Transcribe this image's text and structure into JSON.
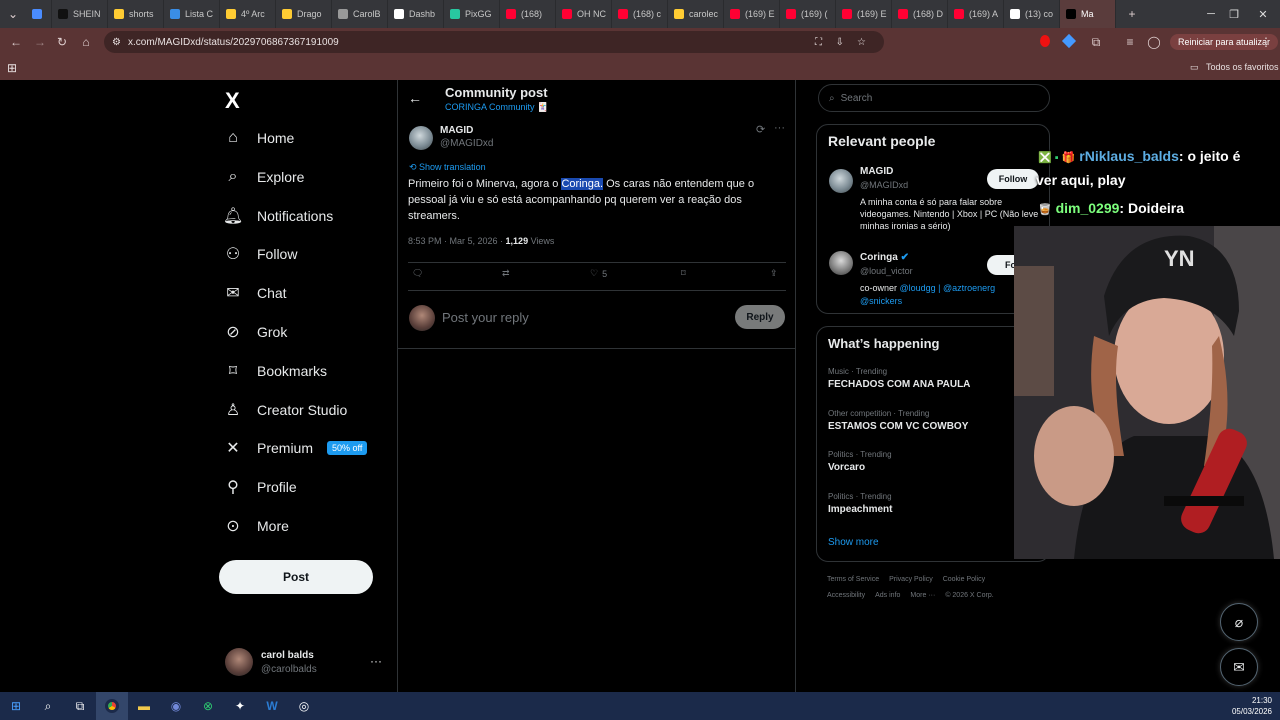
{
  "browser": {
    "tabs": [
      {
        "label": "",
        "color": "#4a8cff"
      },
      {
        "label": "SHEIN",
        "color": "#111111"
      },
      {
        "label": "shorts",
        "color": "#ffcc33"
      },
      {
        "label": "Lista C",
        "color": "#3a8ee6"
      },
      {
        "label": "4º Arc",
        "color": "#ffcc33"
      },
      {
        "label": "Drago",
        "color": "#ffcc33"
      },
      {
        "label": "CarolB",
        "color": "#999999"
      },
      {
        "label": "Dashb",
        "color": "#ffffff"
      },
      {
        "label": "PixGG",
        "color": "#28c7a0"
      },
      {
        "label": "(168) ",
        "color": "#ff0033"
      },
      {
        "label": "OH NC",
        "color": "#ff0033"
      },
      {
        "label": "(168) c",
        "color": "#ff0033"
      },
      {
        "label": "carolec",
        "color": "#ffcc33"
      },
      {
        "label": "(169) E",
        "color": "#ff0033"
      },
      {
        "label": "(169) (",
        "color": "#ff0033"
      },
      {
        "label": "(169) E",
        "color": "#ff0033"
      },
      {
        "label": "(168) D",
        "color": "#ff0033"
      },
      {
        "label": "(169) A",
        "color": "#ff0033"
      },
      {
        "label": "(13) co",
        "color": "#ffffff"
      },
      {
        "label": "Ma",
        "color": "#000000"
      }
    ],
    "url": "x.com/MAGIDxd/status/2029706867367191009",
    "update_label": "Reiniciar para atualizar",
    "favorites_label": "Todos os favoritos"
  },
  "nav": {
    "logo": "X",
    "items": [
      {
        "label": "Home",
        "icon": "home-icon"
      },
      {
        "label": "Explore",
        "icon": "search-icon"
      },
      {
        "label": "Notifications",
        "icon": "bell-icon"
      },
      {
        "label": "Follow",
        "icon": "person-add-icon"
      },
      {
        "label": "Chat",
        "icon": "mail-icon"
      },
      {
        "label": "Grok",
        "icon": "grok-icon"
      },
      {
        "label": "Bookmarks",
        "icon": "bookmark-icon"
      },
      {
        "label": "Creator Studio",
        "icon": "creator-icon"
      },
      {
        "label": "Premium",
        "icon": "x-icon"
      },
      {
        "label": "Profile",
        "icon": "person-icon"
      },
      {
        "label": "More",
        "icon": "more-circle-icon"
      }
    ],
    "premium_badge": "50% off",
    "post_label": "Post",
    "account": {
      "name": "carol balds",
      "handle": "@carolbalds"
    }
  },
  "post": {
    "header_title": "Community post",
    "community": "CORINGA Community",
    "author_name": "MAGID",
    "author_handle": "@MAGIDxd",
    "show_translation": "Show translation",
    "text_before": "Primeiro foi o Minerva, agora o ",
    "text_highlight": "Coringa.",
    "text_after": " Os caras não entendem que o pessoal já viu e só está acompanhando pq querem ver a reação dos streamers.",
    "timestamp": "8:53 PM · Mar 5, 2026 · ",
    "views_count": "1,129",
    "views_label": " Views",
    "likes": "5",
    "reply_placeholder": "Post your reply",
    "reply_button": "Reply"
  },
  "sidebar": {
    "search_placeholder": "Search",
    "relevant_title": "Relevant people",
    "people": [
      {
        "name": "MAGID",
        "handle": "@MAGIDxd",
        "bio": "A minha conta é só para falar sobre videogames. Nintendo | Xbox | PC (Não leve minhas ironias a sério)",
        "follow": "Follow"
      },
      {
        "name": "Coringa",
        "handle": "@loud_victor",
        "bio_prefix": "co-owner ",
        "bio_links": "@loudgg | @aztroenerg",
        "bio_line2": "@snickers",
        "follow": "Foll"
      }
    ],
    "happening_title": "What’s happening",
    "trends": [
      {
        "meta": "Music · Trending",
        "title": "FECHADOS COM ANA PAULA"
      },
      {
        "meta": "Other competition · Trending",
        "title": "ESTAMOS COM VC COWBOY"
      },
      {
        "meta": "Politics · Trending",
        "title": "Vorcaro"
      },
      {
        "meta": "Politics · Trending",
        "title": "Impeachment"
      }
    ],
    "show_more": "Show more",
    "footer_links": [
      "Terms of Service",
      "Privacy Policy",
      "Cookie Policy",
      "Accessibility",
      "Ads info",
      "More ···",
      "© 2026 X Corp."
    ]
  },
  "stream_chat": [
    {
      "user": "rNiklaus_balds",
      "msg": ": o jeito é"
    },
    {
      "user": "",
      "msg": "ver aqui, play"
    },
    {
      "user": "dim_0299",
      "msg": ": Doideira"
    }
  ],
  "taskbar": {
    "time": "21:30",
    "date": "05/03/2026"
  }
}
